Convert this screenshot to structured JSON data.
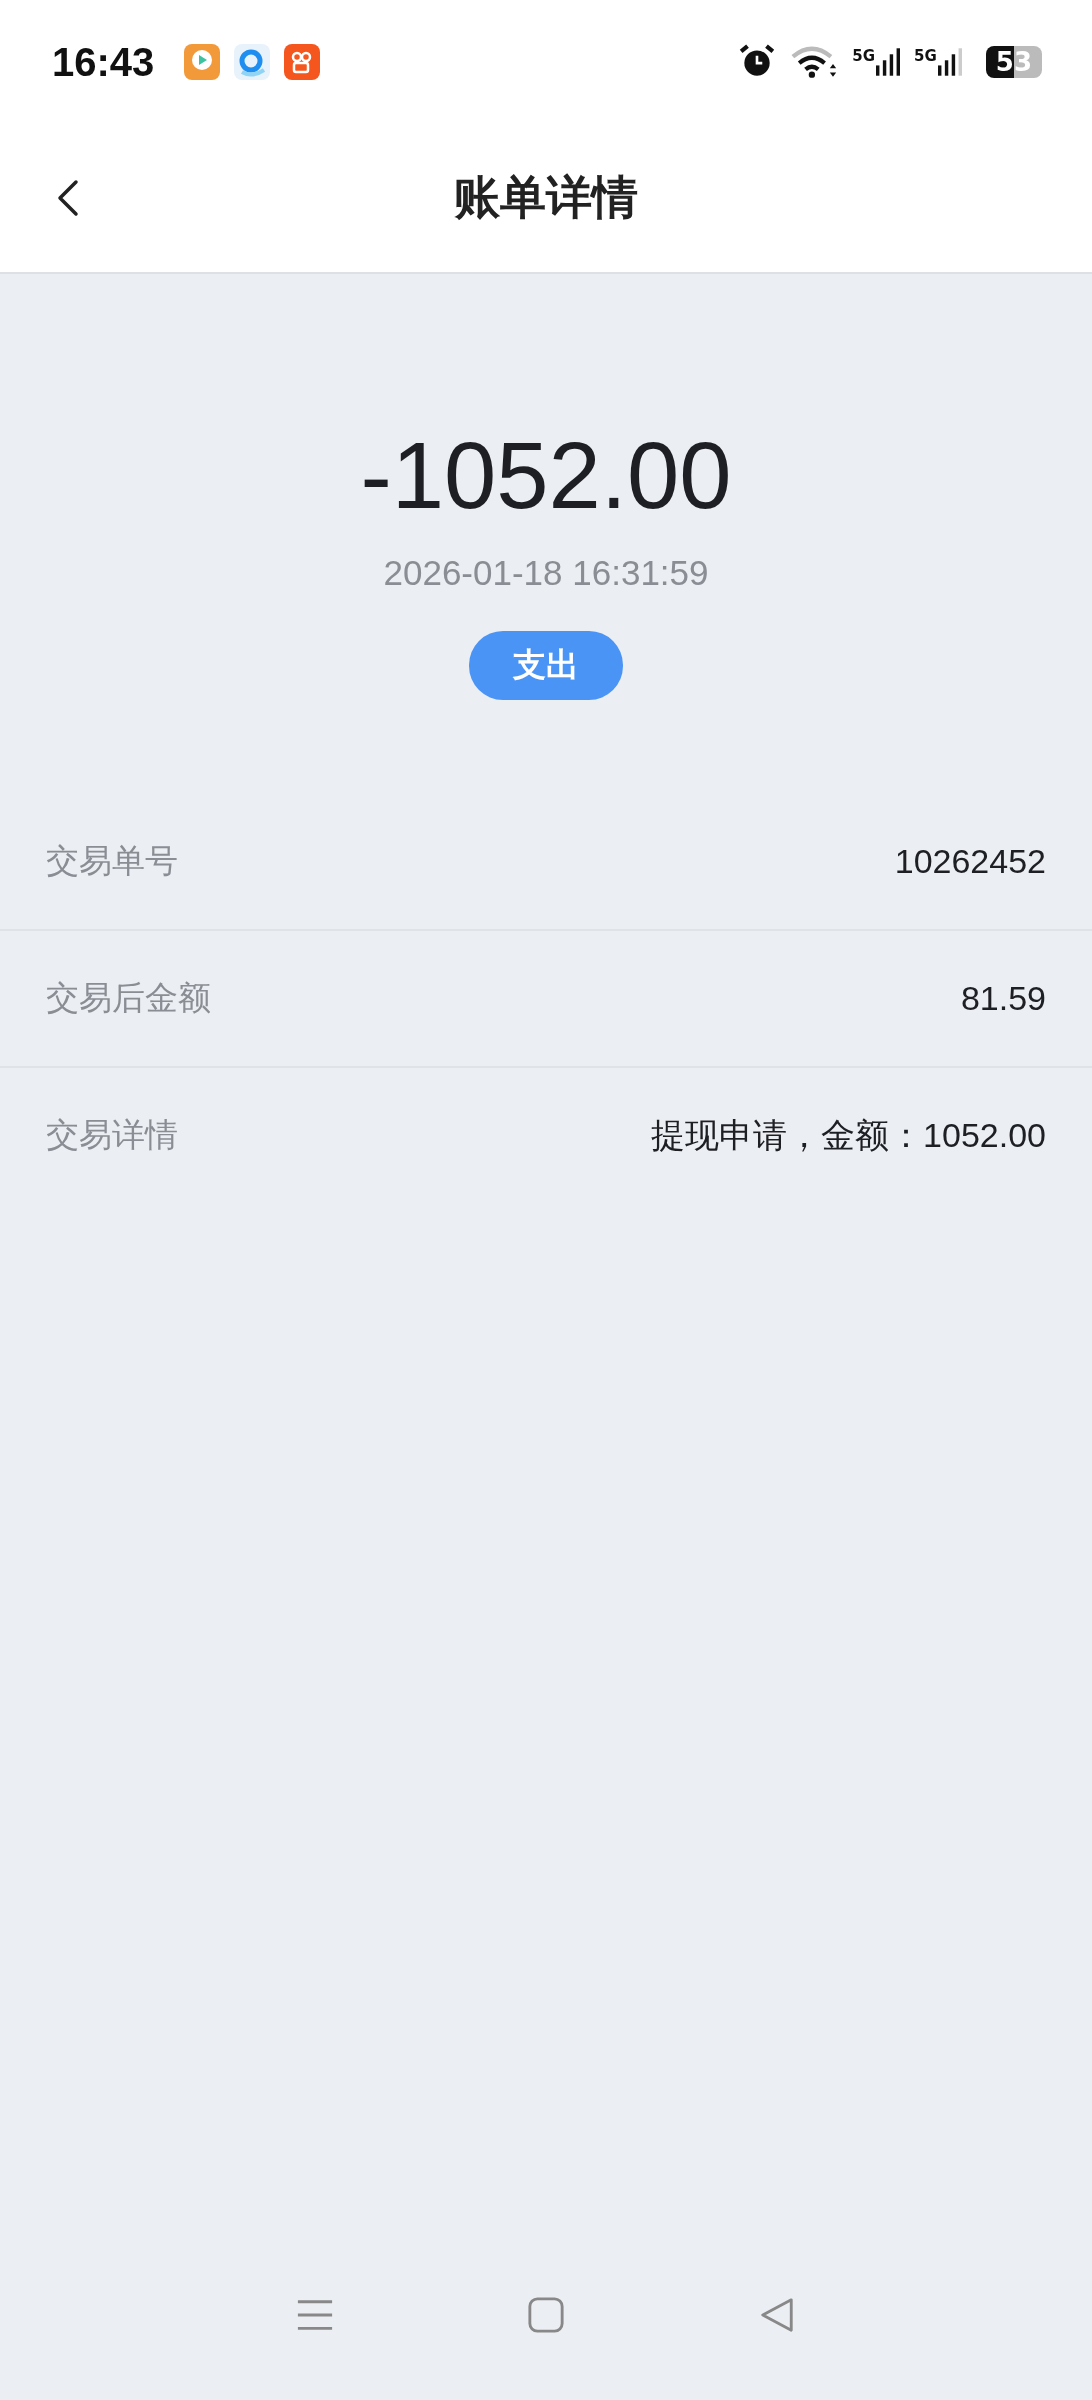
{
  "status_bar": {
    "time": "16:43",
    "network_1": "5G",
    "network_2": "5G",
    "battery": "53"
  },
  "header": {
    "title": "账单详情"
  },
  "summary": {
    "amount": "-1052.00",
    "datetime": "2026-01-18 16:31:59",
    "type_badge": "支出"
  },
  "details": [
    {
      "label": "交易单号",
      "value": "10262452"
    },
    {
      "label": "交易后金额",
      "value": "81.59"
    },
    {
      "label": "交易详情",
      "value": "提现申请，金额：1052.00"
    }
  ]
}
